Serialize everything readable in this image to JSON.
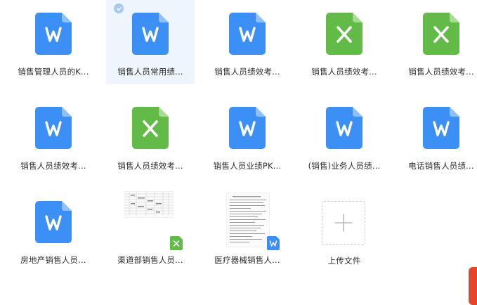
{
  "files": [
    {
      "name": "销售管理人员的K...",
      "type": "word"
    },
    {
      "name": "销售人员常用绩...",
      "type": "word",
      "selected": true
    },
    {
      "name": "销售人员绩效考...",
      "type": "word"
    },
    {
      "name": "销售人员绩效考...",
      "type": "excel"
    },
    {
      "name": "销售人员绩效考...",
      "type": "excel"
    },
    {
      "name": "销售人员绩效考...",
      "type": "word"
    },
    {
      "name": "销售人员绩效考...",
      "type": "excel"
    },
    {
      "name": "销售人员业绩PK...",
      "type": "word"
    },
    {
      "name": "(销售)业务人员绩...",
      "type": "word"
    },
    {
      "name": "电话销售人员绩...",
      "type": "word"
    },
    {
      "name": "房地产销售人员...",
      "type": "word"
    },
    {
      "name": "渠道部销售人员...",
      "type": "excel-thumbnail"
    },
    {
      "name": "医疗器械销售人...",
      "type": "word-thumbnail"
    }
  ],
  "upload": {
    "label": "上传文件",
    "icon": "plus-icon"
  },
  "colors": {
    "word": "#3b8ff5",
    "excel": "#62bb46",
    "selected_bg": "#eef5fd",
    "side_tab": "#e8432b"
  }
}
